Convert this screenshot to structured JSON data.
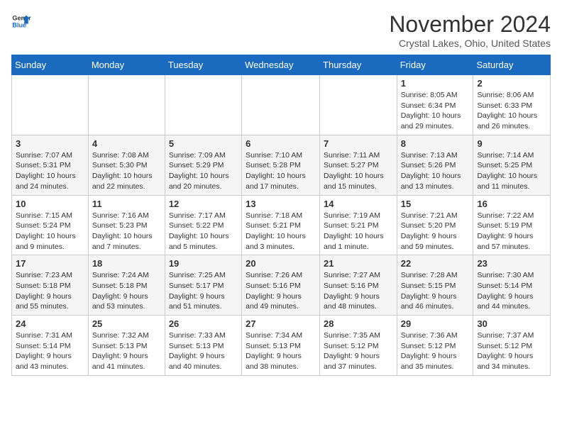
{
  "header": {
    "logo_line1": "General",
    "logo_line2": "Blue",
    "month_title": "November 2024",
    "location": "Crystal Lakes, Ohio, United States"
  },
  "days_of_week": [
    "Sunday",
    "Monday",
    "Tuesday",
    "Wednesday",
    "Thursday",
    "Friday",
    "Saturday"
  ],
  "weeks": [
    [
      {
        "day": "",
        "info": ""
      },
      {
        "day": "",
        "info": ""
      },
      {
        "day": "",
        "info": ""
      },
      {
        "day": "",
        "info": ""
      },
      {
        "day": "",
        "info": ""
      },
      {
        "day": "1",
        "info": "Sunrise: 8:05 AM\nSunset: 6:34 PM\nDaylight: 10 hours and 29 minutes."
      },
      {
        "day": "2",
        "info": "Sunrise: 8:06 AM\nSunset: 6:33 PM\nDaylight: 10 hours and 26 minutes."
      }
    ],
    [
      {
        "day": "3",
        "info": "Sunrise: 7:07 AM\nSunset: 5:31 PM\nDaylight: 10 hours and 24 minutes."
      },
      {
        "day": "4",
        "info": "Sunrise: 7:08 AM\nSunset: 5:30 PM\nDaylight: 10 hours and 22 minutes."
      },
      {
        "day": "5",
        "info": "Sunrise: 7:09 AM\nSunset: 5:29 PM\nDaylight: 10 hours and 20 minutes."
      },
      {
        "day": "6",
        "info": "Sunrise: 7:10 AM\nSunset: 5:28 PM\nDaylight: 10 hours and 17 minutes."
      },
      {
        "day": "7",
        "info": "Sunrise: 7:11 AM\nSunset: 5:27 PM\nDaylight: 10 hours and 15 minutes."
      },
      {
        "day": "8",
        "info": "Sunrise: 7:13 AM\nSunset: 5:26 PM\nDaylight: 10 hours and 13 minutes."
      },
      {
        "day": "9",
        "info": "Sunrise: 7:14 AM\nSunset: 5:25 PM\nDaylight: 10 hours and 11 minutes."
      }
    ],
    [
      {
        "day": "10",
        "info": "Sunrise: 7:15 AM\nSunset: 5:24 PM\nDaylight: 10 hours and 9 minutes."
      },
      {
        "day": "11",
        "info": "Sunrise: 7:16 AM\nSunset: 5:23 PM\nDaylight: 10 hours and 7 minutes."
      },
      {
        "day": "12",
        "info": "Sunrise: 7:17 AM\nSunset: 5:22 PM\nDaylight: 10 hours and 5 minutes."
      },
      {
        "day": "13",
        "info": "Sunrise: 7:18 AM\nSunset: 5:21 PM\nDaylight: 10 hours and 3 minutes."
      },
      {
        "day": "14",
        "info": "Sunrise: 7:19 AM\nSunset: 5:21 PM\nDaylight: 10 hours and 1 minute."
      },
      {
        "day": "15",
        "info": "Sunrise: 7:21 AM\nSunset: 5:20 PM\nDaylight: 9 hours and 59 minutes."
      },
      {
        "day": "16",
        "info": "Sunrise: 7:22 AM\nSunset: 5:19 PM\nDaylight: 9 hours and 57 minutes."
      }
    ],
    [
      {
        "day": "17",
        "info": "Sunrise: 7:23 AM\nSunset: 5:18 PM\nDaylight: 9 hours and 55 minutes."
      },
      {
        "day": "18",
        "info": "Sunrise: 7:24 AM\nSunset: 5:18 PM\nDaylight: 9 hours and 53 minutes."
      },
      {
        "day": "19",
        "info": "Sunrise: 7:25 AM\nSunset: 5:17 PM\nDaylight: 9 hours and 51 minutes."
      },
      {
        "day": "20",
        "info": "Sunrise: 7:26 AM\nSunset: 5:16 PM\nDaylight: 9 hours and 49 minutes."
      },
      {
        "day": "21",
        "info": "Sunrise: 7:27 AM\nSunset: 5:16 PM\nDaylight: 9 hours and 48 minutes."
      },
      {
        "day": "22",
        "info": "Sunrise: 7:28 AM\nSunset: 5:15 PM\nDaylight: 9 hours and 46 minutes."
      },
      {
        "day": "23",
        "info": "Sunrise: 7:30 AM\nSunset: 5:14 PM\nDaylight: 9 hours and 44 minutes."
      }
    ],
    [
      {
        "day": "24",
        "info": "Sunrise: 7:31 AM\nSunset: 5:14 PM\nDaylight: 9 hours and 43 minutes."
      },
      {
        "day": "25",
        "info": "Sunrise: 7:32 AM\nSunset: 5:13 PM\nDaylight: 9 hours and 41 minutes."
      },
      {
        "day": "26",
        "info": "Sunrise: 7:33 AM\nSunset: 5:13 PM\nDaylight: 9 hours and 40 minutes."
      },
      {
        "day": "27",
        "info": "Sunrise: 7:34 AM\nSunset: 5:13 PM\nDaylight: 9 hours and 38 minutes."
      },
      {
        "day": "28",
        "info": "Sunrise: 7:35 AM\nSunset: 5:12 PM\nDaylight: 9 hours and 37 minutes."
      },
      {
        "day": "29",
        "info": "Sunrise: 7:36 AM\nSunset: 5:12 PM\nDaylight: 9 hours and 35 minutes."
      },
      {
        "day": "30",
        "info": "Sunrise: 7:37 AM\nSunset: 5:12 PM\nDaylight: 9 hours and 34 minutes."
      }
    ]
  ]
}
